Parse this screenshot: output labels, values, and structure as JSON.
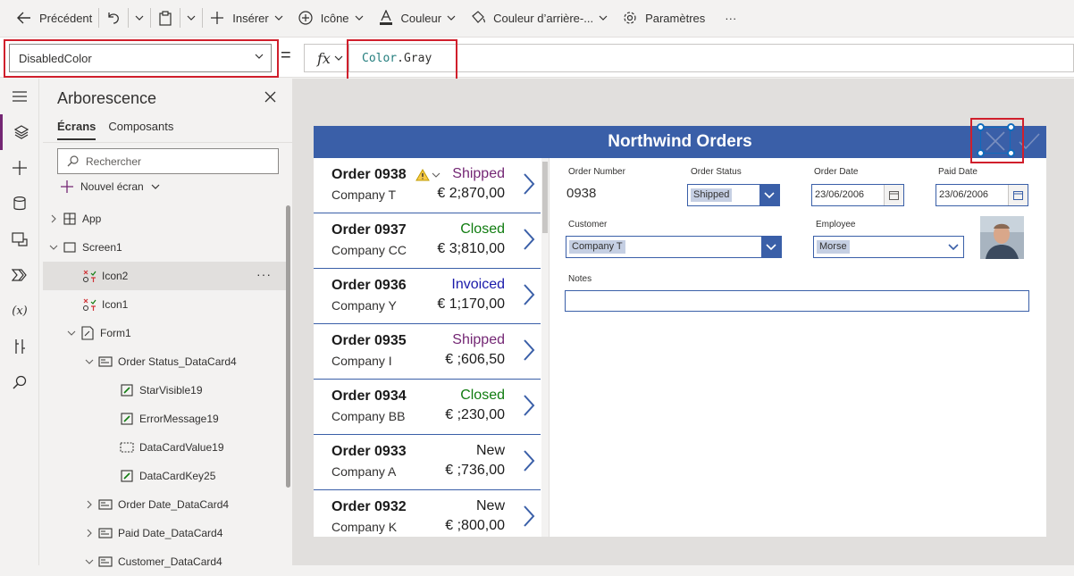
{
  "colors": {
    "accent": "#3a5fa8",
    "brand": "#742774",
    "highlight": "#d01f2c",
    "shipped": "#742774",
    "closed": "#107c10",
    "invoiced": "#1a1aaa",
    "new": "#1b1b1b"
  },
  "toolbar": {
    "back": "Précédent",
    "insert": "Insérer",
    "icon": "Icône",
    "color": "Couleur",
    "fill": "Couleur d’arrière-...",
    "settings": "Paramètres",
    "more": "···"
  },
  "formula": {
    "property": "DisabledColor",
    "eq": "=",
    "fx": "fx",
    "object": "Color",
    "member": ".Gray"
  },
  "tree": {
    "title": "Arborescence",
    "tabs": [
      "Écrans",
      "Composants"
    ],
    "search_placeholder": "Rechercher",
    "new_screen": "Nouvel écran",
    "items": [
      {
        "label": "App"
      },
      {
        "label": "Screen1"
      },
      {
        "label": "Icon2",
        "more": "···"
      },
      {
        "label": "Icon1"
      },
      {
        "label": "Form1"
      },
      {
        "label": "Order Status_DataCard4"
      },
      {
        "label": "StarVisible19"
      },
      {
        "label": "ErrorMessage19"
      },
      {
        "label": "DataCardValue19"
      },
      {
        "label": "DataCardKey25"
      },
      {
        "label": "Order Date_DataCard4"
      },
      {
        "label": "Paid Date_DataCard4"
      },
      {
        "label": "Customer_DataCard4"
      }
    ]
  },
  "app": {
    "title": "Northwind Orders",
    "orders": [
      {
        "order": "Order 0938",
        "company": "Company T",
        "status": "Shipped",
        "amount": "€ 2;870,00"
      },
      {
        "order": "Order 0937",
        "company": "Company CC",
        "status": "Closed",
        "amount": "€ 3;810,00"
      },
      {
        "order": "Order 0936",
        "company": "Company Y",
        "status": "Invoiced",
        "amount": "€ 1;170,00"
      },
      {
        "order": "Order 0935",
        "company": "Company I",
        "status": "Shipped",
        "amount": "€ ;606,50"
      },
      {
        "order": "Order 0934",
        "company": "Company BB",
        "status": "Closed",
        "amount": "€ ;230,00"
      },
      {
        "order": "Order 0933",
        "company": "Company A",
        "status": "New",
        "amount": "€ ;736,00"
      },
      {
        "order": "Order 0932",
        "company": "Company K",
        "status": "New",
        "amount": "€ ;800,00"
      }
    ],
    "form": {
      "order_number_label": "Order Number",
      "order_number": "0938",
      "order_status_label": "Order Status",
      "order_status": "Shipped",
      "order_date_label": "Order Date",
      "order_date": "23/06/2006",
      "paid_date_label": "Paid Date",
      "paid_date": "23/06/2006",
      "customer_label": "Customer",
      "customer": "Company T",
      "employee_label": "Employee",
      "employee": "Morse",
      "notes_label": "Notes"
    }
  }
}
